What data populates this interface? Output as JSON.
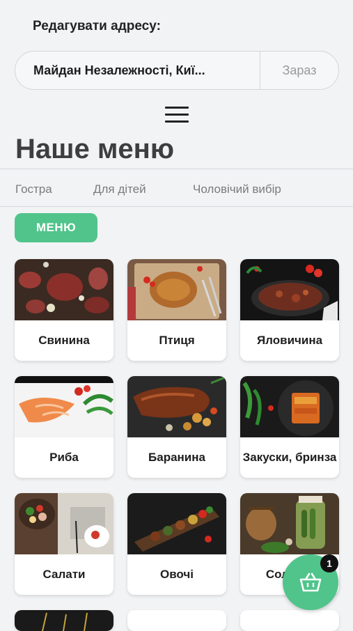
{
  "header": {
    "edit_address_label": "Редагувати адресу:",
    "address_value": "Майдан Незалежності, Киї...",
    "time_option": "Зараз"
  },
  "page_title": "Наше меню",
  "tabs": [
    {
      "label": "Гостра"
    },
    {
      "label": "Для дітей"
    },
    {
      "label": "Чоловічий вибір"
    }
  ],
  "menu_button": "МЕНЮ",
  "categories": [
    {
      "label": "Свинина"
    },
    {
      "label": "Птиця"
    },
    {
      "label": "Яловичина"
    },
    {
      "label": "Риба"
    },
    {
      "label": "Баранина"
    },
    {
      "label": "Закуски, бринза"
    },
    {
      "label": "Салати"
    },
    {
      "label": "Овочі"
    },
    {
      "label": "Соління"
    }
  ],
  "cart": {
    "count": "1",
    "icon": "basket-icon"
  },
  "colors": {
    "accent": "#50c48b",
    "background": "#f2f3f5"
  }
}
